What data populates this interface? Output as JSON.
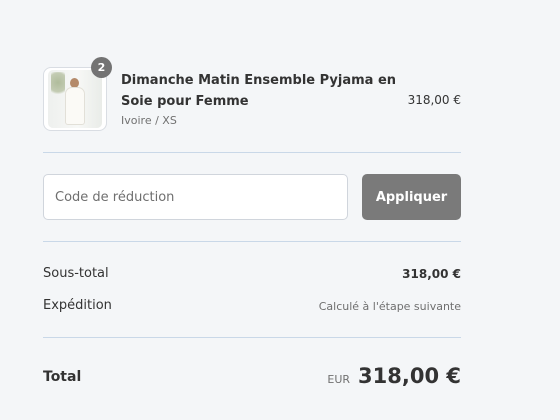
{
  "cart": {
    "item": {
      "quantity": "2",
      "name": "Dimanche Matin Ensemble Pyjama en Soie pour Femme",
      "variant": "Ivoire / XS",
      "price": "318,00 €",
      "thumbnail_icon": "product-photo"
    }
  },
  "discount": {
    "placeholder": "Code de réduction",
    "value": "",
    "apply_label": "Appliquer"
  },
  "summary": {
    "subtotal_label": "Sous-total",
    "subtotal_value": "318,00 €",
    "shipping_label": "Expédition",
    "shipping_value": "Calculé à l'étape suivante"
  },
  "total": {
    "label": "Total",
    "currency": "EUR",
    "amount": "318,00 €"
  },
  "colors": {
    "background": "#f4f6f8",
    "divider": "#c9d8e8",
    "button": "#7a7a7a",
    "badge": "#737373",
    "text": "#333333"
  }
}
